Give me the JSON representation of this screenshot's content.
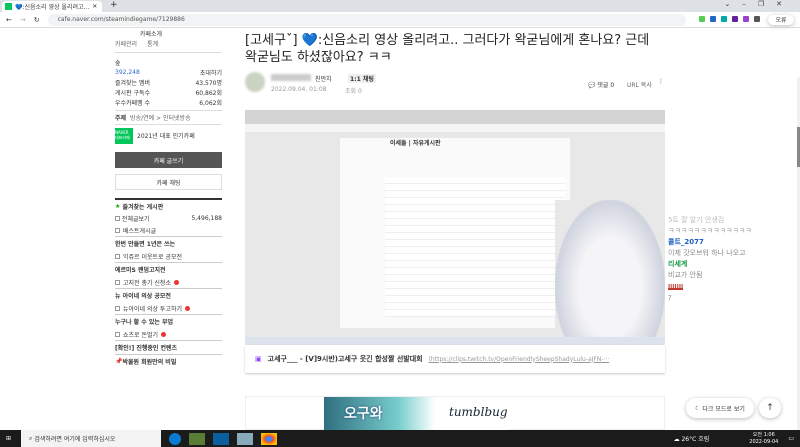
{
  "browser": {
    "tab_title": "💙:신음소리 영상 올리려고...",
    "url": "cafe.naver.com/steamindiegame/7129886",
    "profile_label": "오류"
  },
  "sidebar": {
    "cafe_intro": "카페소개",
    "links": [
      "카페관리",
      "통계"
    ],
    "level": "숲",
    "members": "392,248",
    "invite": "초대하기",
    "stats": [
      {
        "label": "즐겨찾는 멤버",
        "value": "43,570명"
      },
      {
        "label": "게시판 구독수",
        "value": "60,862회"
      },
      {
        "label": "우수카페멤 수",
        "value": "6,062회"
      }
    ],
    "topic_label": "주제",
    "topic": "방송/연예 > 인터넷방송",
    "award": "2021년 대표 인기카페",
    "award_badge": "NAVER 대표카페",
    "write_button": "카페 글쓰기",
    "chat_button": "카페 채팅",
    "fav_header": "즐겨찾는 게시판",
    "boards": [
      {
        "label": "전체글보기",
        "count": "5,496,188"
      },
      {
        "label": "베스트게시글"
      }
    ],
    "sections": [
      {
        "title": "한번 만들면 1년은 쓰는",
        "items": [
          "익쥬르 이웃트로 공모전"
        ]
      },
      {
        "title": "에르미S 랜덤고지전",
        "items": [
          "고지전 총기 신청소"
        ]
      },
      {
        "title": "뉴 아이네 의상 공모전",
        "items": [
          "뉴아이네 의상 투고하기"
        ]
      },
      {
        "title": "누구나 할 수 있는 부업",
        "items": [
          "쇼츠로 돈벌기"
        ]
      },
      {
        "title": "[확인!] 진행중인 컨텐츠",
        "items": []
      }
    ],
    "secret": "박물원 회원만의 비밀"
  },
  "article": {
    "title": "[고세구ˇ] 💙:신음소리 영상 올리려고.. 그러다가 왁굳님에게 혼나요? 근데 왁굳님도 하셨잖아요? ㅋㅋ",
    "author_suffix": "친먼치",
    "chat_badge": "1:1 채팅",
    "date": "2022.09.04. 01:08",
    "views": "조회 0",
    "comments": "댓글 0",
    "url_copy": "URL 복사"
  },
  "linkcard": {
    "title": "고세구___ - [V]9시반)고세구 웃긴 합성짤 선발대회",
    "url": "(https://clips.twitch.tv/OpenFriendlySheepShadyLulu-aJFN-···"
  },
  "video": {
    "board_title": "이세돌 | 자유게시판"
  },
  "chat": [
    {
      "name": "5트 잘 알기 안생김",
      "name_color": "#bbb",
      "msg": "ㅋㅋㅋㅋㅋㅋㅋㅋㅋㅋㅋㅋㅋ"
    },
    {
      "name": "콜트_2077",
      "name_color": "#1a5fc4",
      "msg": "이제 갓오브워 하나 나오고"
    },
    {
      "name": "리세계",
      "name_color": "#1a9b4a",
      "msg": "비교가 안됨"
    },
    {
      "name": "IIIIIIII",
      "name_color": "#c0392b",
      "msg": "?"
    }
  ],
  "banner": {
    "left": "오구와",
    "right": "tumblbug"
  },
  "buttons": {
    "dark_mode": "다크 모드로 보기",
    "top": "↑"
  },
  "taskbar": {
    "search": "검색하려면 여기에 입력하십시오",
    "weather": "26°C 흐림",
    "time": "오전 1:06",
    "date": "2022-09-04"
  }
}
